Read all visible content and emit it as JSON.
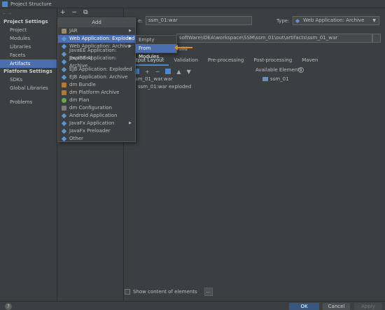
{
  "window": {
    "title": "Project Structure"
  },
  "sidebar": {
    "sections": [
      {
        "label": "Project Settings",
        "items": [
          "Project",
          "Modules",
          "Libraries",
          "Facets",
          "Artifacts"
        ]
      },
      {
        "label": "Platform Settings",
        "items": [
          "SDKs",
          "Global Libraries"
        ]
      }
    ],
    "problems": "Problems",
    "selected": "Artifacts"
  },
  "mid_toolbar": {
    "add": "+",
    "remove": "−",
    "copy": "⧉"
  },
  "add_popup": {
    "title": "Add",
    "items": [
      {
        "label": "JAR",
        "icon": "jar-icon",
        "submenu": true
      },
      {
        "label": "Web Application: Exploded",
        "icon": "web-artifact-icon",
        "submenu": true,
        "highlighted": true
      },
      {
        "label": "Web Application: Archive",
        "icon": "web-artifact-icon",
        "submenu": true
      },
      {
        "label": "JavaEE Application: Exploded",
        "icon": "javaee-icon",
        "submenu": false
      },
      {
        "label": "JavaEE Application: Archive",
        "icon": "javaee-icon",
        "submenu": false
      },
      {
        "label": "EJB Application: Exploded",
        "icon": "ejb-icon",
        "submenu": false
      },
      {
        "label": "EJB Application: Archive",
        "icon": "ejb-icon",
        "submenu": false
      },
      {
        "label": "dm Bundle",
        "icon": "dm-bundle-icon",
        "submenu": false
      },
      {
        "label": "dm Platform Archive",
        "icon": "dm-archive-icon",
        "submenu": false
      },
      {
        "label": "dm Plan",
        "icon": "dm-plan-icon",
        "submenu": false
      },
      {
        "label": "dm Configuration",
        "icon": "dm-config-icon",
        "submenu": false
      },
      {
        "label": "Android Application",
        "icon": "android-icon",
        "submenu": false
      },
      {
        "label": "JavaFx Application",
        "icon": "javafx-icon",
        "submenu": true
      },
      {
        "label": "JavaFx Preloader",
        "icon": "javafx-icon",
        "submenu": false
      },
      {
        "label": "Other",
        "icon": "other-icon",
        "submenu": false
      }
    ]
  },
  "submenu": {
    "items": [
      "Empty",
      "From Modules..."
    ],
    "highlighted": "From Modules..."
  },
  "artifact": {
    "name_label": "e:",
    "name_value": "ssm_01:war",
    "type_label": "Type:",
    "type_value": "Web Application: Archive",
    "output_path": "softWare\\IDEA\\workspace\\SSM\\ssm_01\\out\\artifacts\\ssm_01_war",
    "build_label": "uild"
  },
  "tabs": [
    "Output Layout",
    "Validation",
    "Pre-processing",
    "Post-processing",
    "Maven"
  ],
  "active_tab": "Output Layout",
  "available_elements": "Available Elements",
  "available_help": "?",
  "tree": {
    "root": "sm_01_war.war",
    "child": "ssm_01:war exploded"
  },
  "available_module": "ssm_01",
  "show_content": "Show content of elements",
  "dots_button": "...",
  "footer": {
    "help": "?",
    "ok": "OK",
    "cancel": "Cancel",
    "apply": "Apply"
  },
  "colors": {
    "accent": "#4b6eaf",
    "ok": "#365880",
    "arrow": "#e08a1e"
  }
}
